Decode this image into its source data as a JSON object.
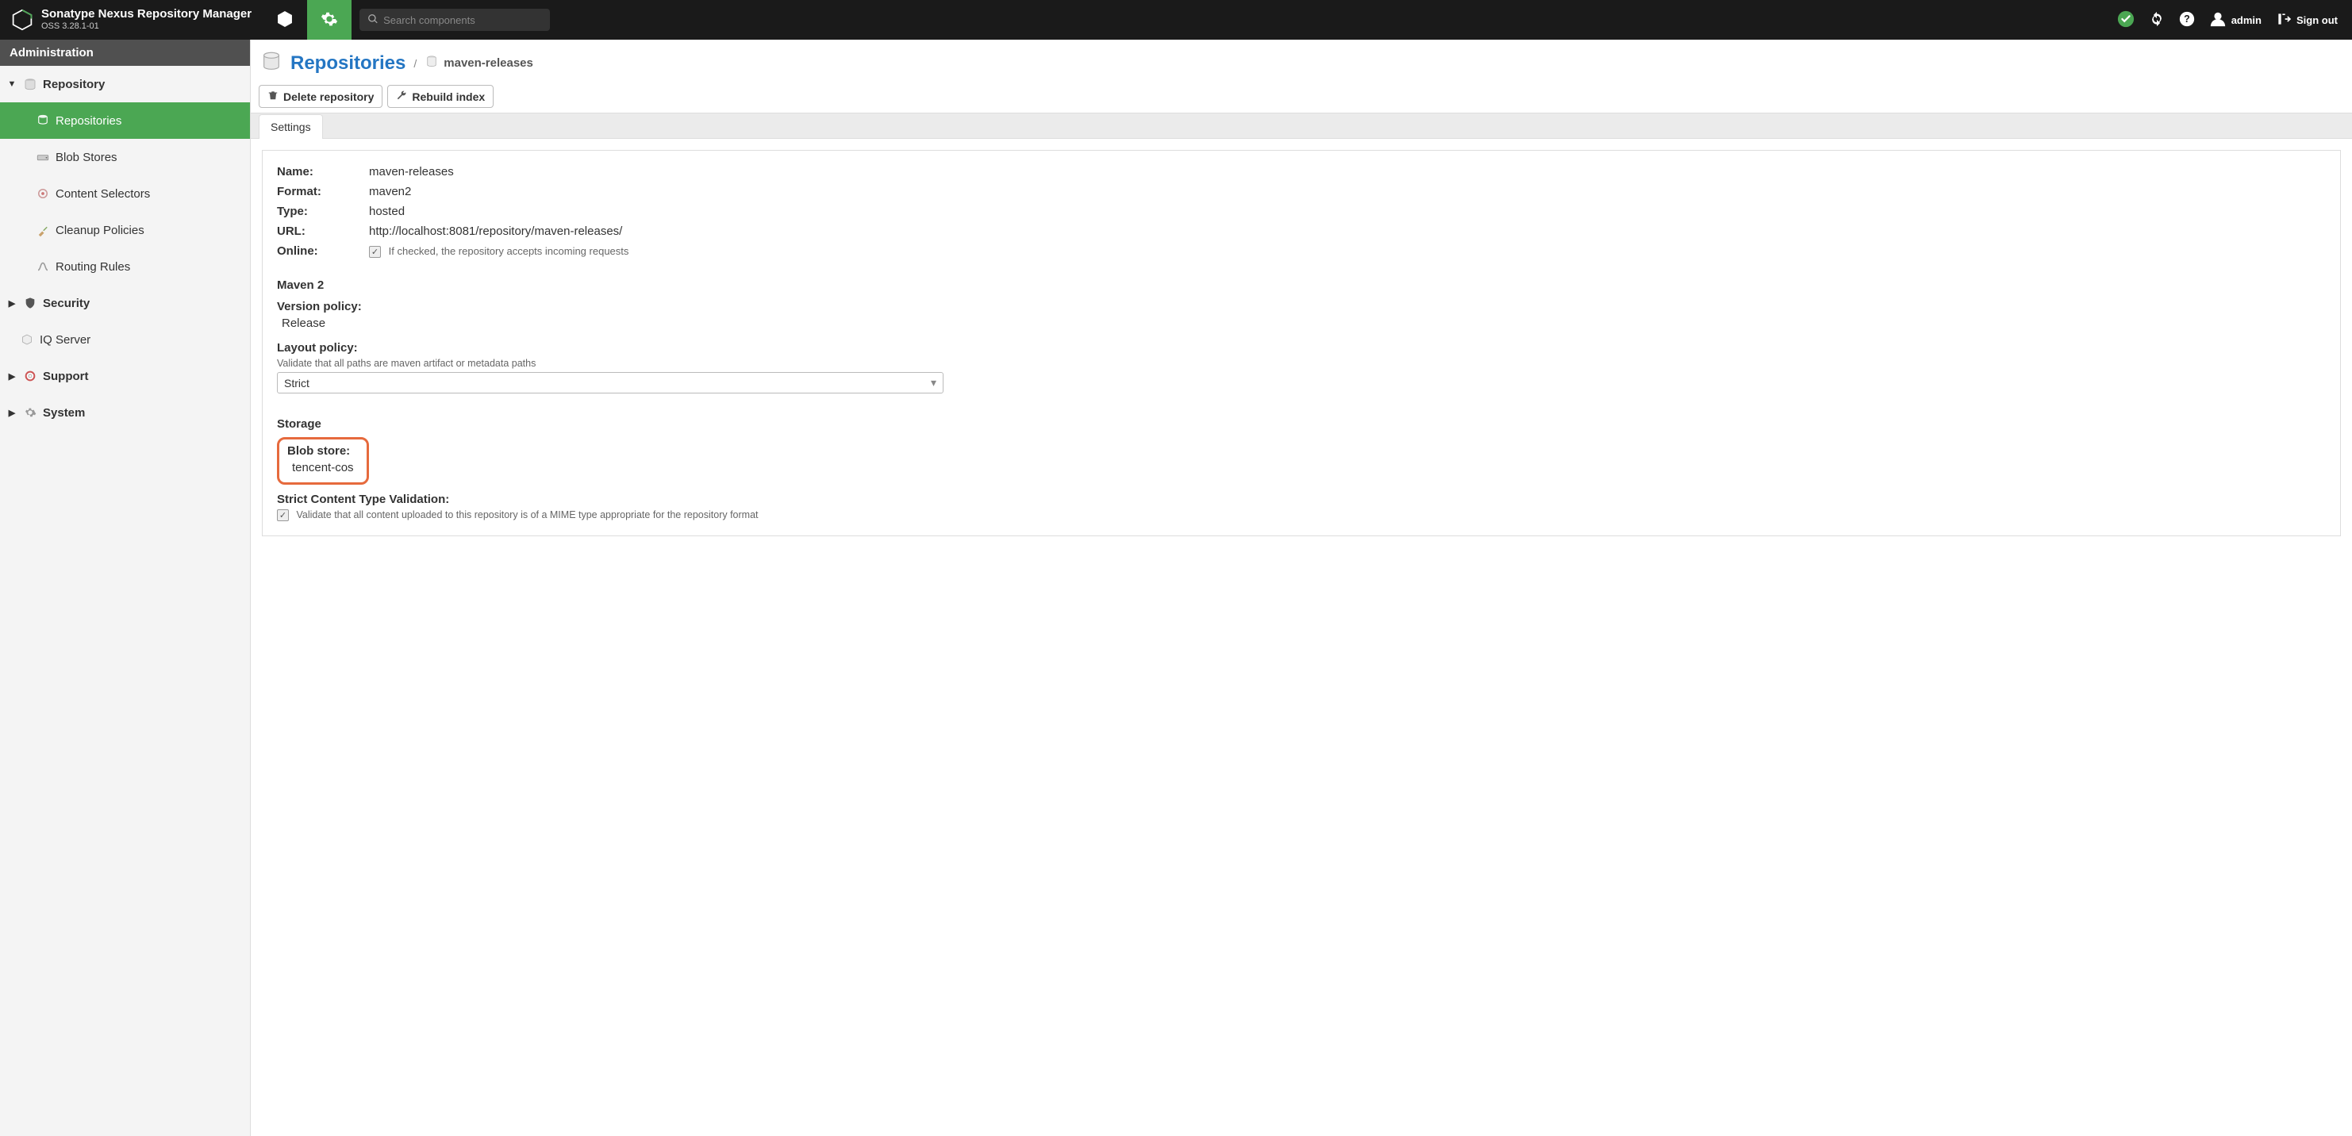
{
  "header": {
    "product_title": "Sonatype Nexus Repository Manager",
    "product_subtitle": "OSS 3.28.1-01",
    "search_placeholder": "Search components",
    "username": "admin",
    "signout": "Sign out"
  },
  "sidebar": {
    "heading": "Administration",
    "items": [
      {
        "label": "Repository",
        "icon": "folder",
        "depth": 0,
        "expanded": true,
        "selected": false
      },
      {
        "label": "Repositories",
        "icon": "database",
        "depth": 1,
        "selected": true
      },
      {
        "label": "Blob Stores",
        "icon": "hdd",
        "depth": 1,
        "selected": false
      },
      {
        "label": "Content Selectors",
        "icon": "target",
        "depth": 1,
        "selected": false
      },
      {
        "label": "Cleanup Policies",
        "icon": "broom",
        "depth": 1,
        "selected": false
      },
      {
        "label": "Routing Rules",
        "icon": "route",
        "depth": 1,
        "selected": false
      },
      {
        "label": "Security",
        "icon": "shield",
        "depth": 0,
        "expanded": false,
        "selected": false
      },
      {
        "label": "IQ Server",
        "icon": "iq",
        "depth": 0,
        "expanded": null,
        "selected": false
      },
      {
        "label": "Support",
        "icon": "lifebuoy",
        "depth": 0,
        "expanded": false,
        "selected": false
      },
      {
        "label": "System",
        "icon": "gear",
        "depth": 0,
        "expanded": false,
        "selected": false
      }
    ]
  },
  "breadcrumb": {
    "root": "Repositories",
    "leaf": "maven-releases"
  },
  "toolbar": {
    "delete_label": "Delete repository",
    "rebuild_label": "Rebuild index"
  },
  "tabs": {
    "settings": "Settings"
  },
  "details": {
    "name_label": "Name:",
    "name_value": "maven-releases",
    "format_label": "Format:",
    "format_value": "maven2",
    "type_label": "Type:",
    "type_value": "hosted",
    "url_label": "URL:",
    "url_value": "http://localhost:8081/repository/maven-releases/",
    "online_label": "Online:",
    "online_help": "If checked, the repository accepts incoming requests",
    "maven_section": "Maven 2",
    "version_policy_label": "Version policy:",
    "version_policy_value": "Release",
    "layout_policy_label": "Layout policy:",
    "layout_policy_help": "Validate that all paths are maven artifact or metadata paths",
    "layout_policy_value": "Strict",
    "storage_section": "Storage",
    "blob_store_label": "Blob store:",
    "blob_store_value": "tencent-cos",
    "strict_content_label": "Strict Content Type Validation:",
    "strict_content_help": "Validate that all content uploaded to this repository is of a MIME type appropriate for the repository format"
  }
}
